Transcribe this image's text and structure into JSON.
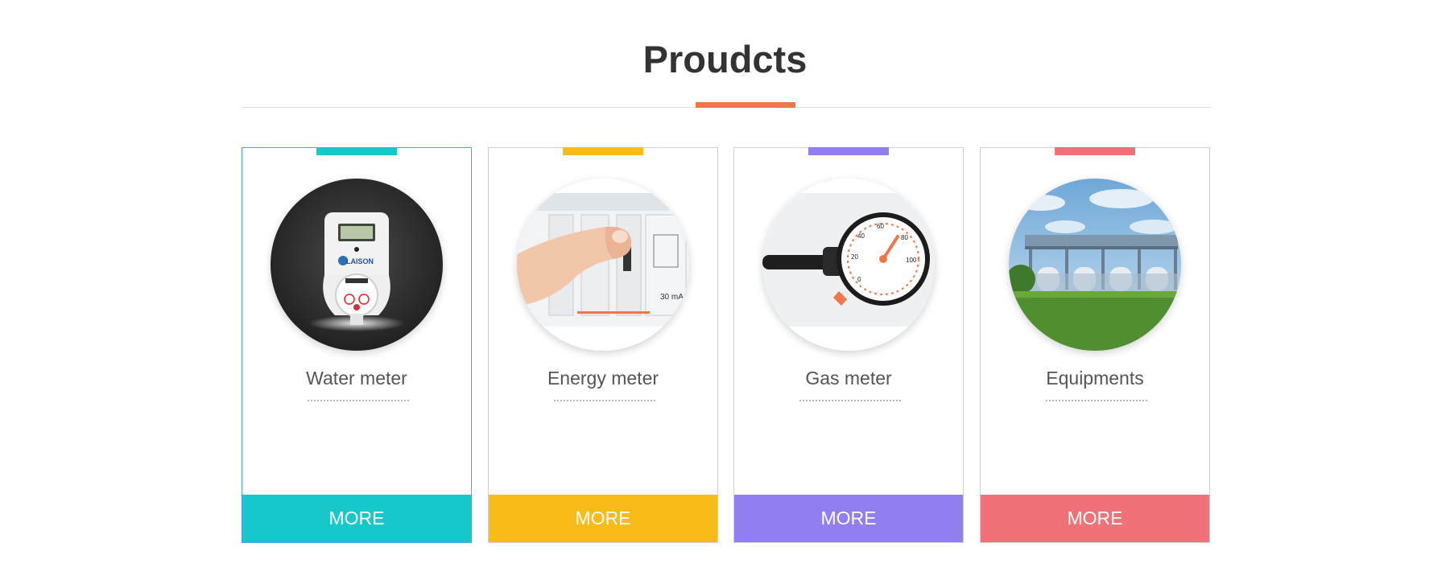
{
  "section": {
    "title": "Proudcts",
    "accent_color": "#f07646"
  },
  "products": [
    {
      "name": "Water meter",
      "button_label": "MORE",
      "color": "#16c8c9",
      "image_icon": "water-meter-photo",
      "image_text": "LAISON",
      "active": true
    },
    {
      "name": "Energy meter",
      "button_label": "MORE",
      "color": "#f8bb18",
      "image_icon": "circuit-breaker-photo",
      "image_text": "30 mA"
    },
    {
      "name": "Gas meter",
      "button_label": "MORE",
      "color": "#917ff0",
      "image_icon": "pressure-gauge-photo",
      "image_ticks": [
        "0",
        "20",
        "40",
        "60",
        "80",
        "100"
      ]
    },
    {
      "name": "Equipments",
      "button_label": "MORE",
      "color": "#f07177",
      "image_icon": "industrial-plant-photo"
    }
  ]
}
